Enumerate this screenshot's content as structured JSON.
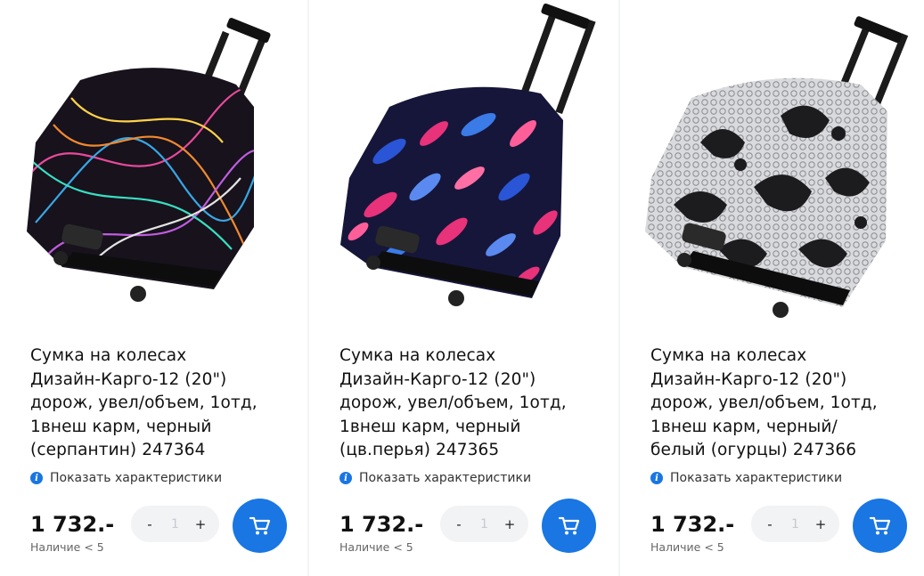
{
  "products": [
    {
      "title": "Сумка на колесах\nДизайн-Карго-12 (20\")\nдорож, увел/объем, 1отд,\n1внеш карм, черный\n(серпантин) 247364",
      "specs_label": "Показать характеристики",
      "price": "1 732.-",
      "stock": "Наличие < 5",
      "qty": "1",
      "minus": "-",
      "plus": "+",
      "icon": "cart-icon"
    },
    {
      "title": "Сумка на колесах\nДизайн-Карго-12 (20\")\nдорож, увел/объем, 1отд,\n1внеш карм, черный\n(цв.перья) 247365",
      "specs_label": "Показать характеристики",
      "price": "1 732.-",
      "stock": "Наличие < 5",
      "qty": "1",
      "minus": "-",
      "plus": "+",
      "icon": "cart-icon"
    },
    {
      "title": "Сумка на колесах\nДизайн-Карго-12 (20\")\nдорож, увел/объем, 1отд,\n1внеш карм, черный/\nбелый (огурцы) 247366",
      "specs_label": "Показать характеристики",
      "price": "1 732.-",
      "stock": "Наличие < 5",
      "qty": "1",
      "minus": "-",
      "plus": "+",
      "icon": "cart-icon"
    }
  ],
  "colors": {
    "accent": "#1976e3",
    "background": "#f3f4f6"
  }
}
